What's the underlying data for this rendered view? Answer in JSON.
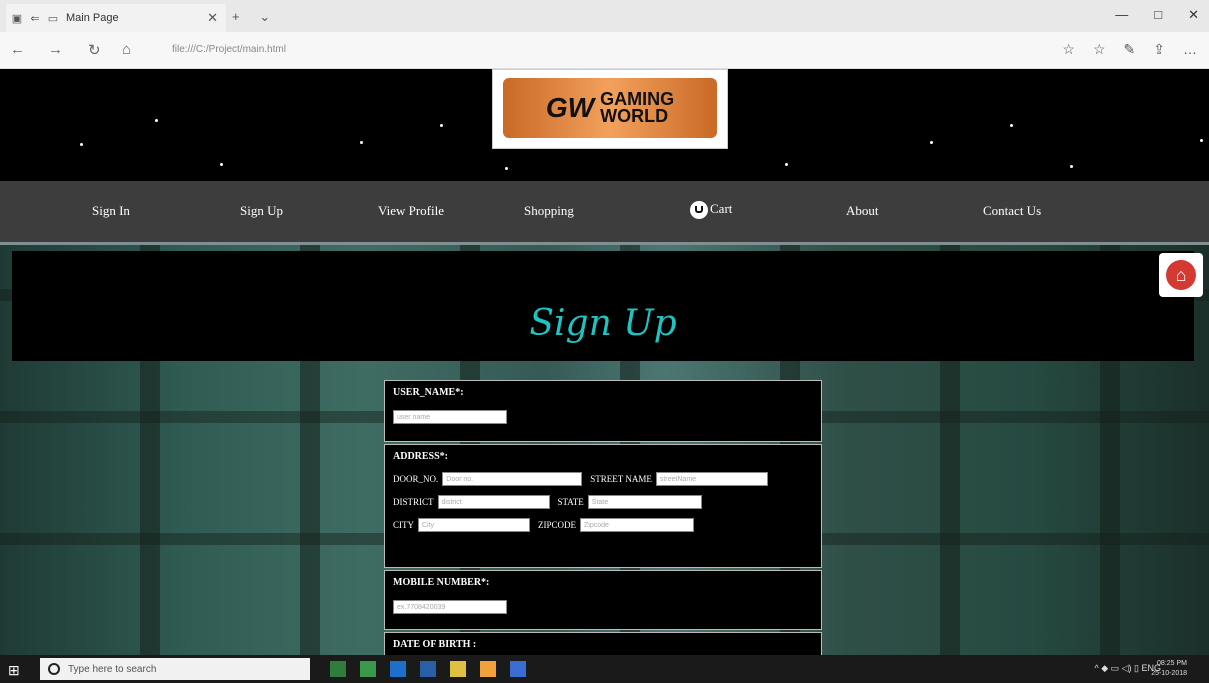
{
  "browser": {
    "tab_title": "Main Page",
    "address": "file:///C:/Project/main.html",
    "nav": [
      "←",
      "→",
      "↻",
      "⌂"
    ],
    "window_controls": [
      "—",
      "□",
      "✕"
    ],
    "toolbar_icons": [
      "☆",
      "☆",
      "✎",
      "⇪",
      "…"
    ]
  },
  "logo": {
    "mark": "GW",
    "line1": "GAMING",
    "line2": "WORLD"
  },
  "menu": [
    {
      "label": "Sign In"
    },
    {
      "label": "Sign Up"
    },
    {
      "label": "View Profile"
    },
    {
      "label": "Shopping"
    },
    {
      "label": "Cart"
    },
    {
      "label": "About"
    },
    {
      "label": "Contact Us"
    }
  ],
  "signup": {
    "title": "Sign Up",
    "home_icon": "home-icon",
    "user_name": {
      "label": "USER_NAME*:",
      "placeholder": "user name"
    },
    "address": {
      "label": "ADDRESS*:",
      "door_label": "DOOR_NO.",
      "door_ph": "Door no.",
      "street_label": "STREET NAME",
      "street_ph": "streetName",
      "district_label": "DISTRICT",
      "district_ph": "district",
      "state_label": "STATE",
      "state_ph": "State",
      "city_label": "CITY",
      "city_ph": "City",
      "zip_label": "ZIPCODE",
      "zip_ph": "Zipcode"
    },
    "mobile": {
      "label": "MOBILE NUMBER*:",
      "placeholder": "ex.7708420039"
    },
    "dob": {
      "label": "DATE OF BIRTH :"
    }
  },
  "taskbar": {
    "search_placeholder": "Type here to search",
    "tray": "^ ◆ ▭ ◁) ▯ ENG",
    "time": "08:25 PM",
    "date": "25-10-2018"
  },
  "colors": {
    "accent": "#20c2c2",
    "menu_bg": "#3d3d3d",
    "logo_orange": "#e8904a"
  }
}
